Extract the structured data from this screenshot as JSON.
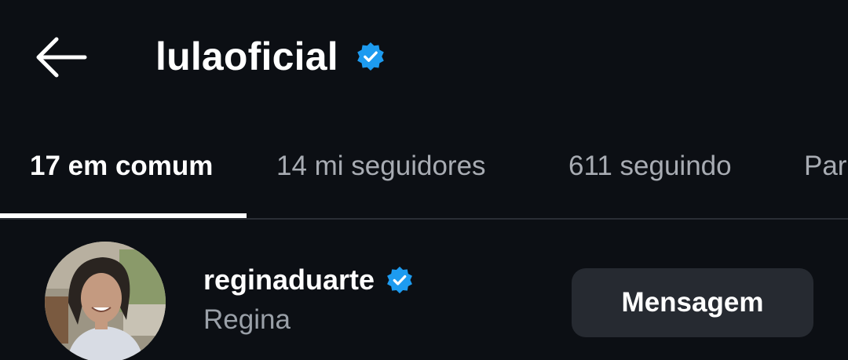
{
  "header": {
    "back_icon": "arrow-left-icon",
    "title": "lulaoficial",
    "verified_icon": "verified-badge-icon"
  },
  "tabs": [
    {
      "label": "17 em comum",
      "active": true
    },
    {
      "label": "14 mi seguidores",
      "active": false
    },
    {
      "label": "611 seguindo",
      "active": false
    },
    {
      "label": "Par",
      "active": false
    }
  ],
  "users": [
    {
      "username": "reginaduarte",
      "display_name": "Regina",
      "verified": true,
      "avatar_icon": "profile-photo",
      "action_label": "Mensagem"
    }
  ],
  "colors": {
    "background": "#0c0f14",
    "verified_blue": "#1d9bf0",
    "button_bg": "#262a31",
    "muted_text": "#9aa0a8",
    "inactive_tab": "#a8acb3"
  }
}
